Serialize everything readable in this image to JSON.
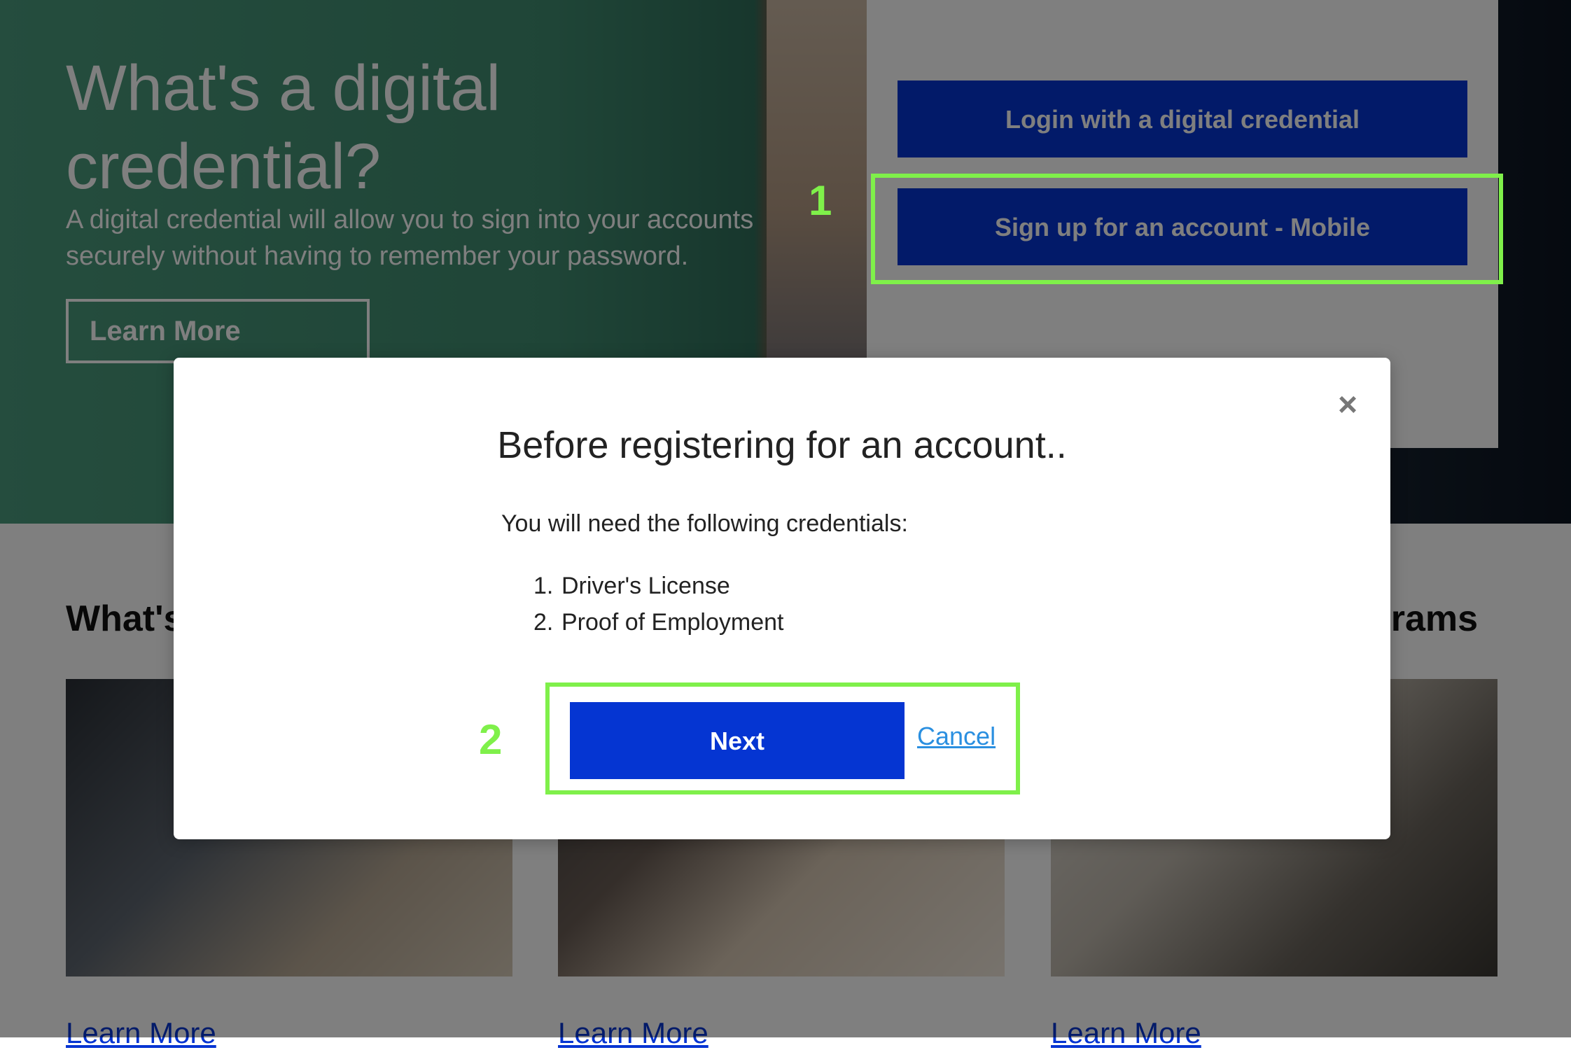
{
  "hero": {
    "title": "What's a digital credential?",
    "description": "A digital credential will allow you to sign into your accounts securely without having to remember your password.",
    "learn_more": "Learn More"
  },
  "login_panel": {
    "login_button": "Login with a digital credential",
    "signup_button": "Sign up for an account - Mobile"
  },
  "sections": {
    "left_heading": "What's",
    "right_heading": "grams",
    "cards": [
      {
        "link": "Learn More"
      },
      {
        "link": "Learn More"
      },
      {
        "link": "Learn More"
      }
    ]
  },
  "modal": {
    "close_symbol": "×",
    "title": "Before registering for an account..",
    "intro": "You will need the following credentials:",
    "items": [
      {
        "num": "1.",
        "label": "Driver's License"
      },
      {
        "num": "2.",
        "label": "Proof of Employment"
      }
    ],
    "next_button": "Next",
    "cancel_link": "Cancel"
  },
  "annotations": {
    "step1": "1",
    "step2": "2"
  },
  "colors": {
    "primary_button": "#0535d2",
    "highlight": "#7ff04a",
    "cancel_link": "#2a8fe0",
    "overlay": "rgba(0,0,0,0.5)"
  }
}
